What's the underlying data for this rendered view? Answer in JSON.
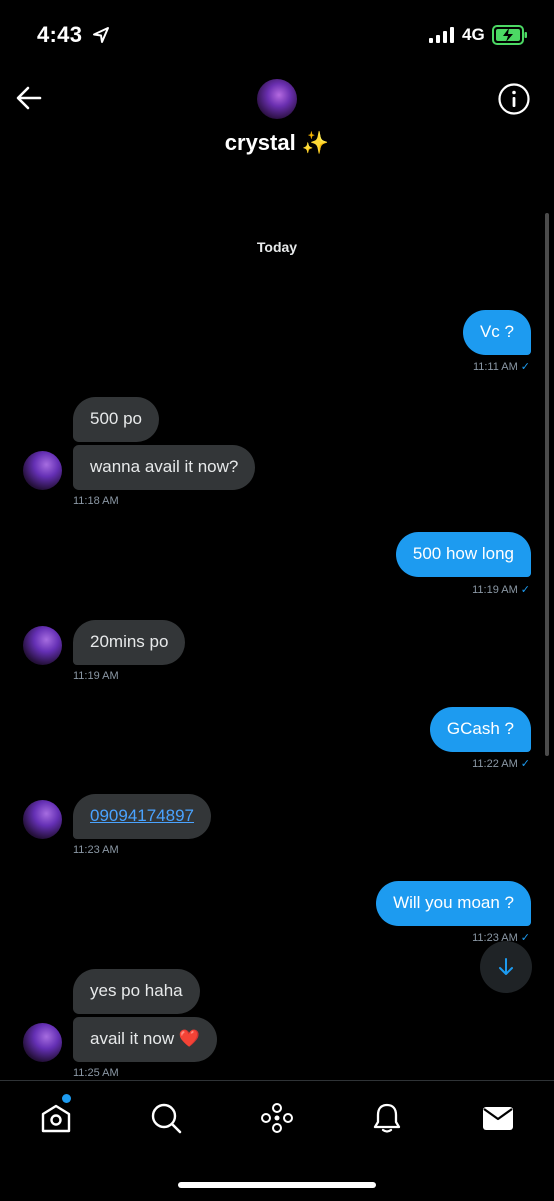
{
  "status_bar": {
    "time": "4:43",
    "network": "4G"
  },
  "header": {
    "name": "crystal ✨"
  },
  "day_label": "Today",
  "messages": {
    "m1": {
      "text": "Vc ?",
      "time": "11:11 AM",
      "read": "✓"
    },
    "m2": {
      "text": "500 po"
    },
    "m3": {
      "text": "wanna avail it now?",
      "time": "11:18 AM"
    },
    "m4": {
      "text": "500 how long",
      "time": "11:19 AM",
      "read": "✓"
    },
    "m5": {
      "text": "20mins po",
      "time": "11:19 AM"
    },
    "m6": {
      "text": "GCash ?",
      "time": "11:22 AM",
      "read": "✓"
    },
    "m7": {
      "text": "09094174897",
      "time": "11:23 AM"
    },
    "m8": {
      "text": "Will you moan ?",
      "time": "11:23 AM",
      "read": "✓"
    },
    "m9": {
      "text": "yes po haha"
    },
    "m10": {
      "text": "avail it now ❤️",
      "time": "11:25 AM"
    }
  },
  "icons": {
    "back": "arrow-left-icon",
    "info": "info-icon",
    "scroll_down": "arrow-down-icon",
    "tabs": [
      "home-icon",
      "search-icon",
      "spaces-icon",
      "bell-icon",
      "mail-icon"
    ]
  },
  "colors": {
    "accent": "#1d9bf0",
    "incoming_bubble": "#333638",
    "background": "#000000"
  }
}
